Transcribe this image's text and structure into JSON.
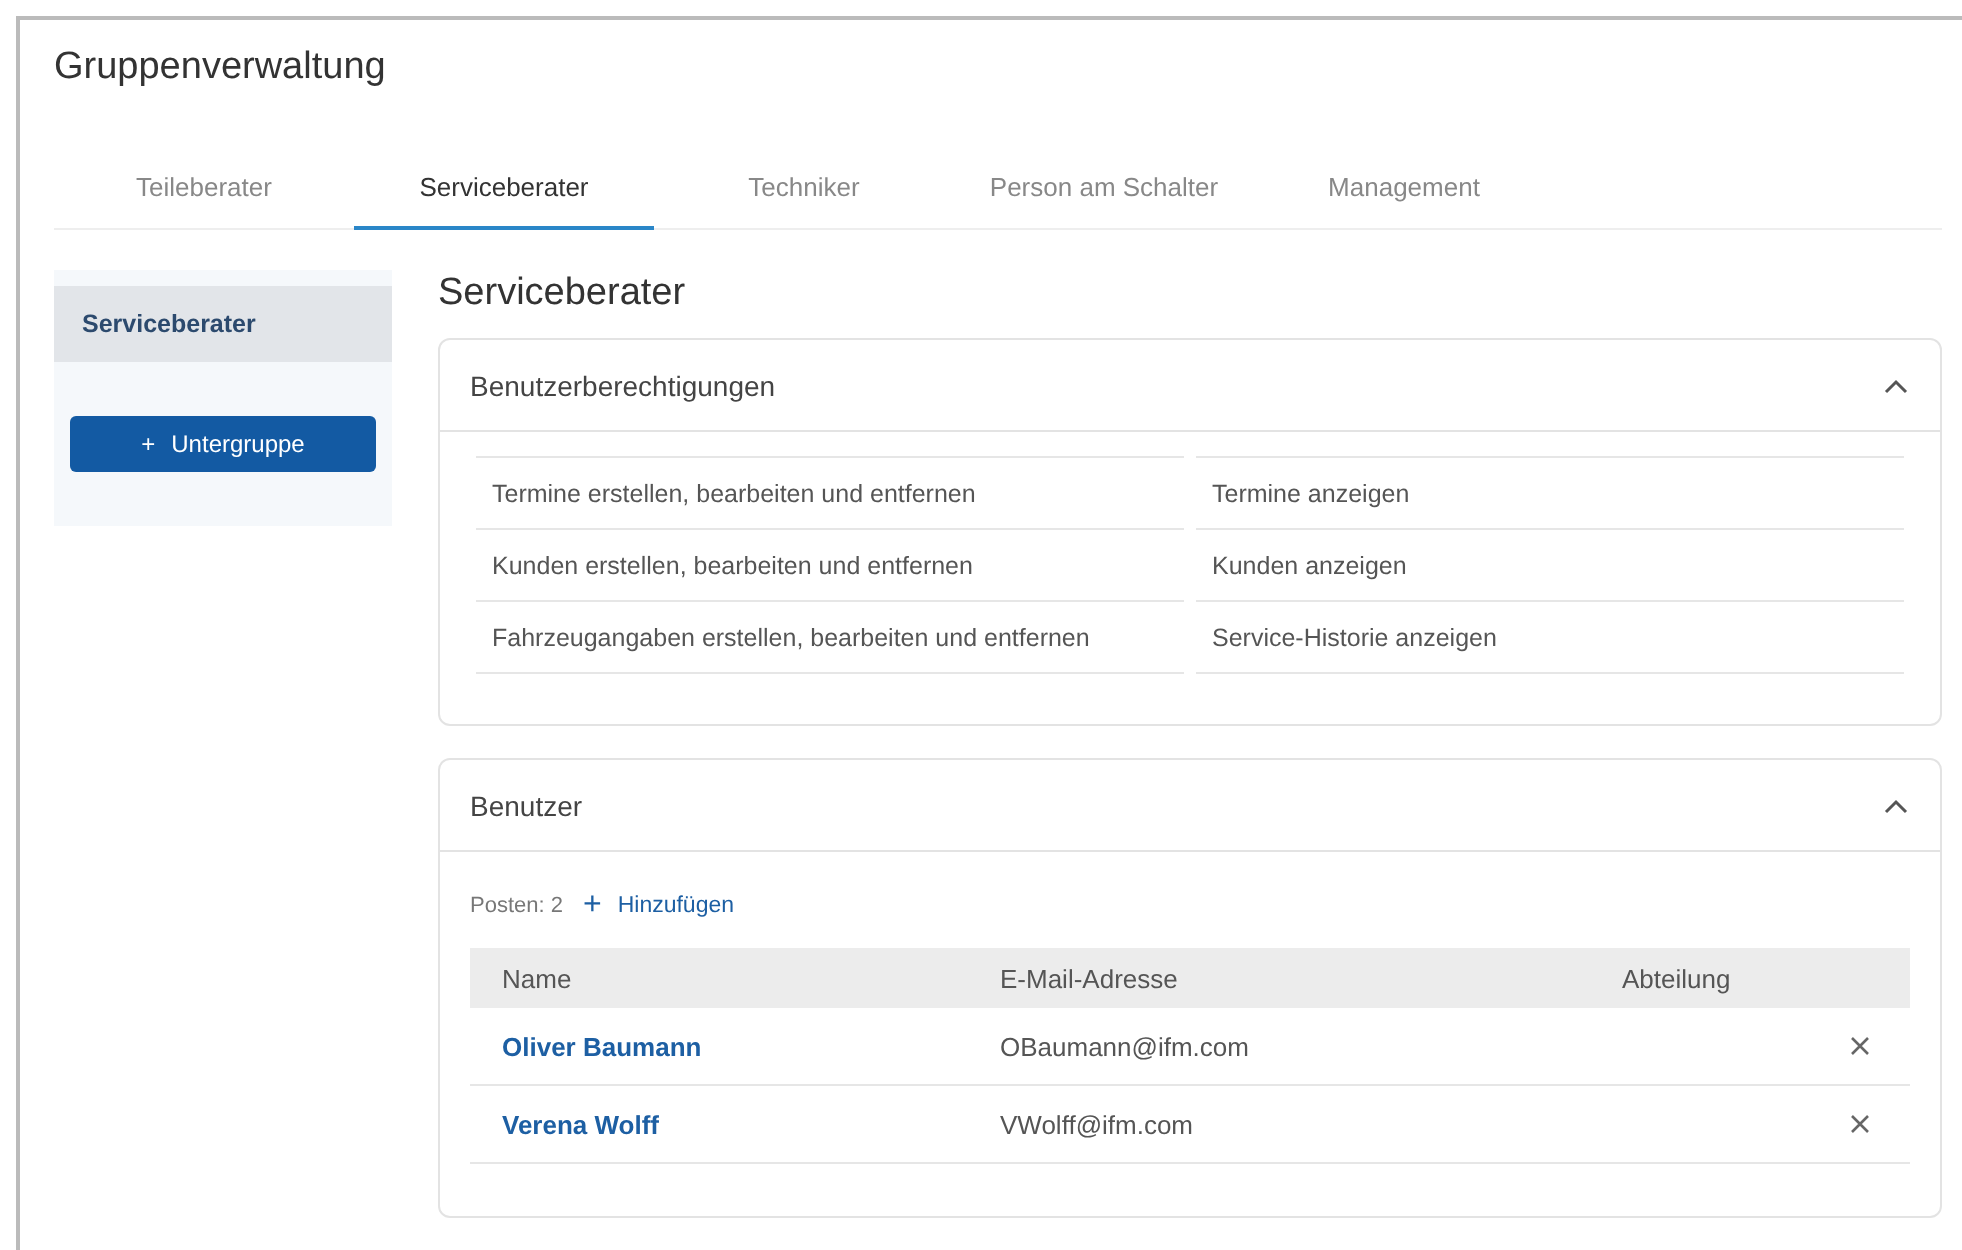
{
  "page": {
    "title": "Gruppenverwaltung"
  },
  "tabs": [
    {
      "label": "Teileberater",
      "selected": false
    },
    {
      "label": "Serviceberater",
      "selected": true
    },
    {
      "label": "Techniker",
      "selected": false
    },
    {
      "label": "Person am Schalter",
      "selected": false
    },
    {
      "label": "Management",
      "selected": false
    }
  ],
  "sidebar": {
    "items": [
      {
        "label": "Serviceberater",
        "selected": true
      }
    ],
    "add_button": {
      "icon": "+",
      "label": "Untergruppe"
    }
  },
  "heading": "Serviceberater",
  "permissions": {
    "title": "Benutzerberechtigungen",
    "expanded": true,
    "items": [
      "Termine erstellen, bearbeiten und entfernen",
      "Termine anzeigen",
      "Kunden erstellen, bearbeiten und entfernen",
      "Kunden anzeigen",
      "Fahrzeugangaben erstellen, bearbeiten und entfernen",
      "Service-Historie anzeigen"
    ]
  },
  "users": {
    "title": "Benutzer",
    "expanded": true,
    "count": "Posten: 2",
    "add_icon": "+",
    "add_label": "Hinzufügen",
    "columns": [
      "Name",
      "E-Mail-Adresse",
      "Abteilung"
    ],
    "rows": [
      {
        "name": "Oliver Baumann",
        "email": "OBaumann@ifm.com",
        "department": ""
      },
      {
        "name": "Verena Wolff",
        "email": "VWolff@ifm.com",
        "department": ""
      }
    ]
  }
}
